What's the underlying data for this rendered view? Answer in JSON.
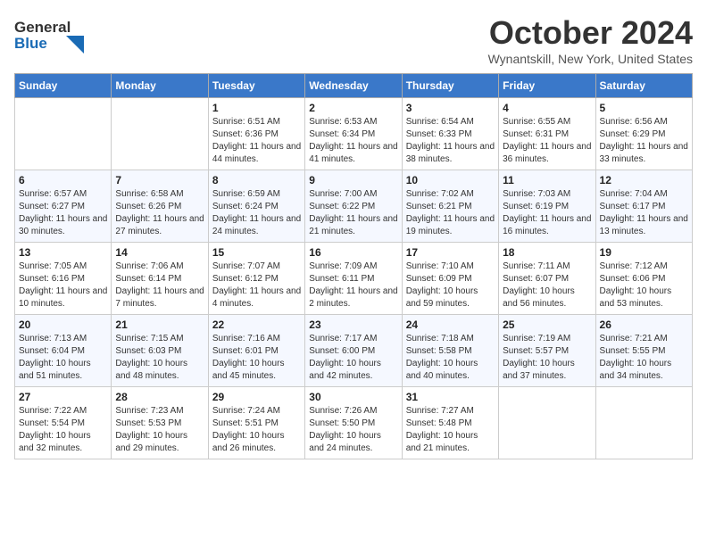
{
  "header": {
    "logo_general": "General",
    "logo_blue": "Blue",
    "month_title": "October 2024",
    "location": "Wynantskill, New York, United States"
  },
  "weekdays": [
    "Sunday",
    "Monday",
    "Tuesday",
    "Wednesday",
    "Thursday",
    "Friday",
    "Saturday"
  ],
  "weeks": [
    [
      {
        "day": "",
        "sunrise": "",
        "sunset": "",
        "daylight": ""
      },
      {
        "day": "",
        "sunrise": "",
        "sunset": "",
        "daylight": ""
      },
      {
        "day": "1",
        "sunrise": "Sunrise: 6:51 AM",
        "sunset": "Sunset: 6:36 PM",
        "daylight": "Daylight: 11 hours and 44 minutes."
      },
      {
        "day": "2",
        "sunrise": "Sunrise: 6:53 AM",
        "sunset": "Sunset: 6:34 PM",
        "daylight": "Daylight: 11 hours and 41 minutes."
      },
      {
        "day": "3",
        "sunrise": "Sunrise: 6:54 AM",
        "sunset": "Sunset: 6:33 PM",
        "daylight": "Daylight: 11 hours and 38 minutes."
      },
      {
        "day": "4",
        "sunrise": "Sunrise: 6:55 AM",
        "sunset": "Sunset: 6:31 PM",
        "daylight": "Daylight: 11 hours and 36 minutes."
      },
      {
        "day": "5",
        "sunrise": "Sunrise: 6:56 AM",
        "sunset": "Sunset: 6:29 PM",
        "daylight": "Daylight: 11 hours and 33 minutes."
      }
    ],
    [
      {
        "day": "6",
        "sunrise": "Sunrise: 6:57 AM",
        "sunset": "Sunset: 6:27 PM",
        "daylight": "Daylight: 11 hours and 30 minutes."
      },
      {
        "day": "7",
        "sunrise": "Sunrise: 6:58 AM",
        "sunset": "Sunset: 6:26 PM",
        "daylight": "Daylight: 11 hours and 27 minutes."
      },
      {
        "day": "8",
        "sunrise": "Sunrise: 6:59 AM",
        "sunset": "Sunset: 6:24 PM",
        "daylight": "Daylight: 11 hours and 24 minutes."
      },
      {
        "day": "9",
        "sunrise": "Sunrise: 7:00 AM",
        "sunset": "Sunset: 6:22 PM",
        "daylight": "Daylight: 11 hours and 21 minutes."
      },
      {
        "day": "10",
        "sunrise": "Sunrise: 7:02 AM",
        "sunset": "Sunset: 6:21 PM",
        "daylight": "Daylight: 11 hours and 19 minutes."
      },
      {
        "day": "11",
        "sunrise": "Sunrise: 7:03 AM",
        "sunset": "Sunset: 6:19 PM",
        "daylight": "Daylight: 11 hours and 16 minutes."
      },
      {
        "day": "12",
        "sunrise": "Sunrise: 7:04 AM",
        "sunset": "Sunset: 6:17 PM",
        "daylight": "Daylight: 11 hours and 13 minutes."
      }
    ],
    [
      {
        "day": "13",
        "sunrise": "Sunrise: 7:05 AM",
        "sunset": "Sunset: 6:16 PM",
        "daylight": "Daylight: 11 hours and 10 minutes."
      },
      {
        "day": "14",
        "sunrise": "Sunrise: 7:06 AM",
        "sunset": "Sunset: 6:14 PM",
        "daylight": "Daylight: 11 hours and 7 minutes."
      },
      {
        "day": "15",
        "sunrise": "Sunrise: 7:07 AM",
        "sunset": "Sunset: 6:12 PM",
        "daylight": "Daylight: 11 hours and 4 minutes."
      },
      {
        "day": "16",
        "sunrise": "Sunrise: 7:09 AM",
        "sunset": "Sunset: 6:11 PM",
        "daylight": "Daylight: 11 hours and 2 minutes."
      },
      {
        "day": "17",
        "sunrise": "Sunrise: 7:10 AM",
        "sunset": "Sunset: 6:09 PM",
        "daylight": "Daylight: 10 hours and 59 minutes."
      },
      {
        "day": "18",
        "sunrise": "Sunrise: 7:11 AM",
        "sunset": "Sunset: 6:07 PM",
        "daylight": "Daylight: 10 hours and 56 minutes."
      },
      {
        "day": "19",
        "sunrise": "Sunrise: 7:12 AM",
        "sunset": "Sunset: 6:06 PM",
        "daylight": "Daylight: 10 hours and 53 minutes."
      }
    ],
    [
      {
        "day": "20",
        "sunrise": "Sunrise: 7:13 AM",
        "sunset": "Sunset: 6:04 PM",
        "daylight": "Daylight: 10 hours and 51 minutes."
      },
      {
        "day": "21",
        "sunrise": "Sunrise: 7:15 AM",
        "sunset": "Sunset: 6:03 PM",
        "daylight": "Daylight: 10 hours and 48 minutes."
      },
      {
        "day": "22",
        "sunrise": "Sunrise: 7:16 AM",
        "sunset": "Sunset: 6:01 PM",
        "daylight": "Daylight: 10 hours and 45 minutes."
      },
      {
        "day": "23",
        "sunrise": "Sunrise: 7:17 AM",
        "sunset": "Sunset: 6:00 PM",
        "daylight": "Daylight: 10 hours and 42 minutes."
      },
      {
        "day": "24",
        "sunrise": "Sunrise: 7:18 AM",
        "sunset": "Sunset: 5:58 PM",
        "daylight": "Daylight: 10 hours and 40 minutes."
      },
      {
        "day": "25",
        "sunrise": "Sunrise: 7:19 AM",
        "sunset": "Sunset: 5:57 PM",
        "daylight": "Daylight: 10 hours and 37 minutes."
      },
      {
        "day": "26",
        "sunrise": "Sunrise: 7:21 AM",
        "sunset": "Sunset: 5:55 PM",
        "daylight": "Daylight: 10 hours and 34 minutes."
      }
    ],
    [
      {
        "day": "27",
        "sunrise": "Sunrise: 7:22 AM",
        "sunset": "Sunset: 5:54 PM",
        "daylight": "Daylight: 10 hours and 32 minutes."
      },
      {
        "day": "28",
        "sunrise": "Sunrise: 7:23 AM",
        "sunset": "Sunset: 5:53 PM",
        "daylight": "Daylight: 10 hours and 29 minutes."
      },
      {
        "day": "29",
        "sunrise": "Sunrise: 7:24 AM",
        "sunset": "Sunset: 5:51 PM",
        "daylight": "Daylight: 10 hours and 26 minutes."
      },
      {
        "day": "30",
        "sunrise": "Sunrise: 7:26 AM",
        "sunset": "Sunset: 5:50 PM",
        "daylight": "Daylight: 10 hours and 24 minutes."
      },
      {
        "day": "31",
        "sunrise": "Sunrise: 7:27 AM",
        "sunset": "Sunset: 5:48 PM",
        "daylight": "Daylight: 10 hours and 21 minutes."
      },
      {
        "day": "",
        "sunrise": "",
        "sunset": "",
        "daylight": ""
      },
      {
        "day": "",
        "sunrise": "",
        "sunset": "",
        "daylight": ""
      }
    ]
  ]
}
